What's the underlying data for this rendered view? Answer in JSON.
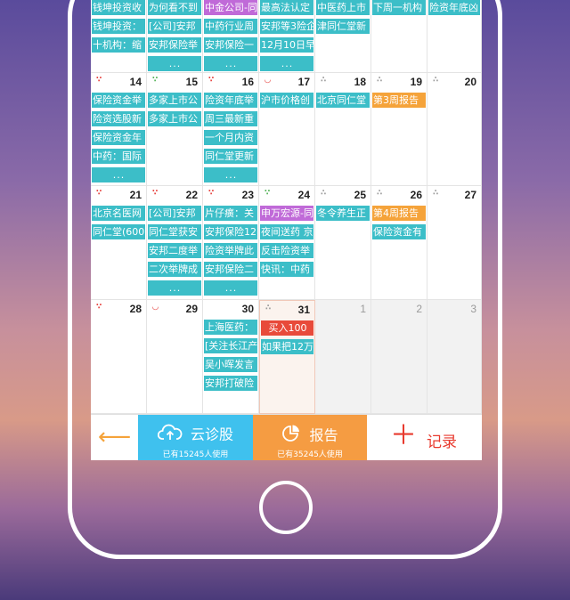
{
  "calendar": {
    "rows": [
      {
        "cells": [
          {
            "day": "",
            "mood": "",
            "events": [
              {
                "text": "钱坤投资收",
                "color": "teal"
              },
              {
                "text": "钱坤投资：",
                "color": "teal"
              },
              {
                "text": "十机构：缩",
                "color": "teal"
              }
            ],
            "more": false
          },
          {
            "day": "",
            "mood": "",
            "events": [
              {
                "text": "为何看不到",
                "color": "teal"
              },
              {
                "text": "[公司]安邦",
                "color": "teal"
              },
              {
                "text": "安邦保险举",
                "color": "teal"
              }
            ],
            "more": true
          },
          {
            "day": "",
            "mood": "",
            "events": [
              {
                "text": "中金公司-同",
                "color": "purple"
              },
              {
                "text": "中药行业周",
                "color": "teal"
              },
              {
                "text": "安邦保险一",
                "color": "teal"
              }
            ],
            "more": true
          },
          {
            "day": "",
            "mood": "",
            "events": [
              {
                "text": "最高法认定",
                "color": "teal"
              },
              {
                "text": "安邦等3险企",
                "color": "teal"
              },
              {
                "text": "12月10日早",
                "color": "teal"
              }
            ],
            "more": true
          },
          {
            "day": "",
            "mood": "",
            "events": [
              {
                "text": "中医药上市",
                "color": "teal"
              },
              {
                "text": "津同仁堂新",
                "color": "teal"
              }
            ],
            "more": false
          },
          {
            "day": "",
            "mood": "",
            "events": [
              {
                "text": "下周一机构",
                "color": "teal"
              }
            ],
            "more": false
          },
          {
            "day": "",
            "mood": "",
            "events": [
              {
                "text": "险资年底凶",
                "color": "teal"
              }
            ],
            "more": false
          }
        ]
      },
      {
        "cells": [
          {
            "day": "14",
            "mood": "good",
            "events": [
              {
                "text": "保险资金举",
                "color": "teal"
              },
              {
                "text": "险资选股新",
                "color": "teal"
              },
              {
                "text": "保险资金年",
                "color": "teal"
              },
              {
                "text": "中药：国际",
                "color": "teal"
              }
            ],
            "more": true
          },
          {
            "day": "15",
            "mood": "ok",
            "events": [
              {
                "text": "多家上市公",
                "color": "teal"
              },
              {
                "text": "多家上市公",
                "color": "teal"
              }
            ],
            "more": false
          },
          {
            "day": "16",
            "mood": "good",
            "events": [
              {
                "text": "险资年底举",
                "color": "teal"
              },
              {
                "text": "周三最新重",
                "color": "teal"
              },
              {
                "text": "一个月内资",
                "color": "teal"
              },
              {
                "text": "同仁堂更新",
                "color": "teal"
              }
            ],
            "more": true
          },
          {
            "day": "17",
            "mood": "happy",
            "events": [
              {
                "text": "沪市价格创",
                "color": "teal"
              }
            ],
            "more": false
          },
          {
            "day": "18",
            "mood": "neutral",
            "events": [
              {
                "text": "北京同仁堂",
                "color": "teal"
              }
            ],
            "more": false
          },
          {
            "day": "19",
            "mood": "neutral",
            "events": [
              {
                "text": "第3周报告",
                "color": "orange"
              }
            ],
            "more": false
          },
          {
            "day": "20",
            "mood": "neutral",
            "events": [],
            "more": false
          }
        ]
      },
      {
        "cells": [
          {
            "day": "21",
            "mood": "good",
            "events": [
              {
                "text": "北京名医网",
                "color": "teal"
              },
              {
                "text": "同仁堂(600",
                "color": "teal"
              }
            ],
            "more": false
          },
          {
            "day": "22",
            "mood": "good",
            "events": [
              {
                "text": "[公司]安邦",
                "color": "teal"
              },
              {
                "text": "同仁堂获安",
                "color": "teal"
              },
              {
                "text": "安邦二度举",
                "color": "teal"
              },
              {
                "text": "二次举牌成",
                "color": "teal"
              }
            ],
            "more": true
          },
          {
            "day": "23",
            "mood": "good",
            "events": [
              {
                "text": "片仔癀：关",
                "color": "teal"
              },
              {
                "text": "安邦保险12",
                "color": "teal"
              },
              {
                "text": "险资举牌此",
                "color": "teal"
              },
              {
                "text": "安邦保险二",
                "color": "teal"
              }
            ],
            "more": true
          },
          {
            "day": "24",
            "mood": "ok",
            "events": [
              {
                "text": "申万宏源-同",
                "color": "purple"
              },
              {
                "text": "夜间送药 京",
                "color": "teal"
              },
              {
                "text": "反击险资举",
                "color": "teal"
              },
              {
                "text": "快讯：中药",
                "color": "teal"
              }
            ],
            "more": false
          },
          {
            "day": "25",
            "mood": "neutral",
            "events": [
              {
                "text": "冬令养生正",
                "color": "teal"
              }
            ],
            "more": false
          },
          {
            "day": "26",
            "mood": "neutral",
            "events": [
              {
                "text": "第4周报告",
                "color": "orange"
              },
              {
                "text": "保险资金有",
                "color": "teal"
              }
            ],
            "more": false
          },
          {
            "day": "27",
            "mood": "neutral",
            "events": [],
            "more": false
          }
        ]
      },
      {
        "cells": [
          {
            "day": "28",
            "mood": "good",
            "events": [],
            "more": false
          },
          {
            "day": "29",
            "mood": "happy",
            "events": [],
            "more": false
          },
          {
            "day": "30",
            "mood": "",
            "events": [
              {
                "text": "上海医药：",
                "color": "teal"
              },
              {
                "text": "[关注长江产",
                "color": "teal"
              },
              {
                "text": "吴小晖发言",
                "color": "teal"
              },
              {
                "text": "安邦打破险",
                "color": "teal"
              }
            ],
            "more": false
          },
          {
            "day": "31",
            "mood": "neutral",
            "events": [
              {
                "text": "买入100",
                "color": "red"
              },
              {
                "text": "如果把12万",
                "color": "teal"
              }
            ],
            "more": false,
            "today": true
          },
          {
            "day": "1",
            "mood": "",
            "events": [],
            "more": false,
            "other": true
          },
          {
            "day": "2",
            "mood": "",
            "events": [],
            "more": false,
            "other": true
          },
          {
            "day": "3",
            "mood": "",
            "events": [],
            "more": false,
            "other": true
          }
        ]
      }
    ],
    "more_label": "..."
  },
  "bottom_bar": {
    "back_icon": "arrow-left-icon",
    "diagnose": {
      "label": "云诊股",
      "sub": "已有15245人使用",
      "icon": "cloud-upload-icon"
    },
    "report": {
      "label": "报告",
      "sub": "已有35245人使用",
      "icon": "pie-chart-icon"
    },
    "record": {
      "label": "记录",
      "icon": "plus-icon"
    }
  },
  "colors": {
    "teal": "#3cbec8",
    "purple": "#c06ad8",
    "orange": "#f5a33a",
    "red": "#e84a3a",
    "diagnose_bg": "#3fc1ee",
    "report_bg": "#f59c42",
    "record_text": "#e83a2e"
  }
}
